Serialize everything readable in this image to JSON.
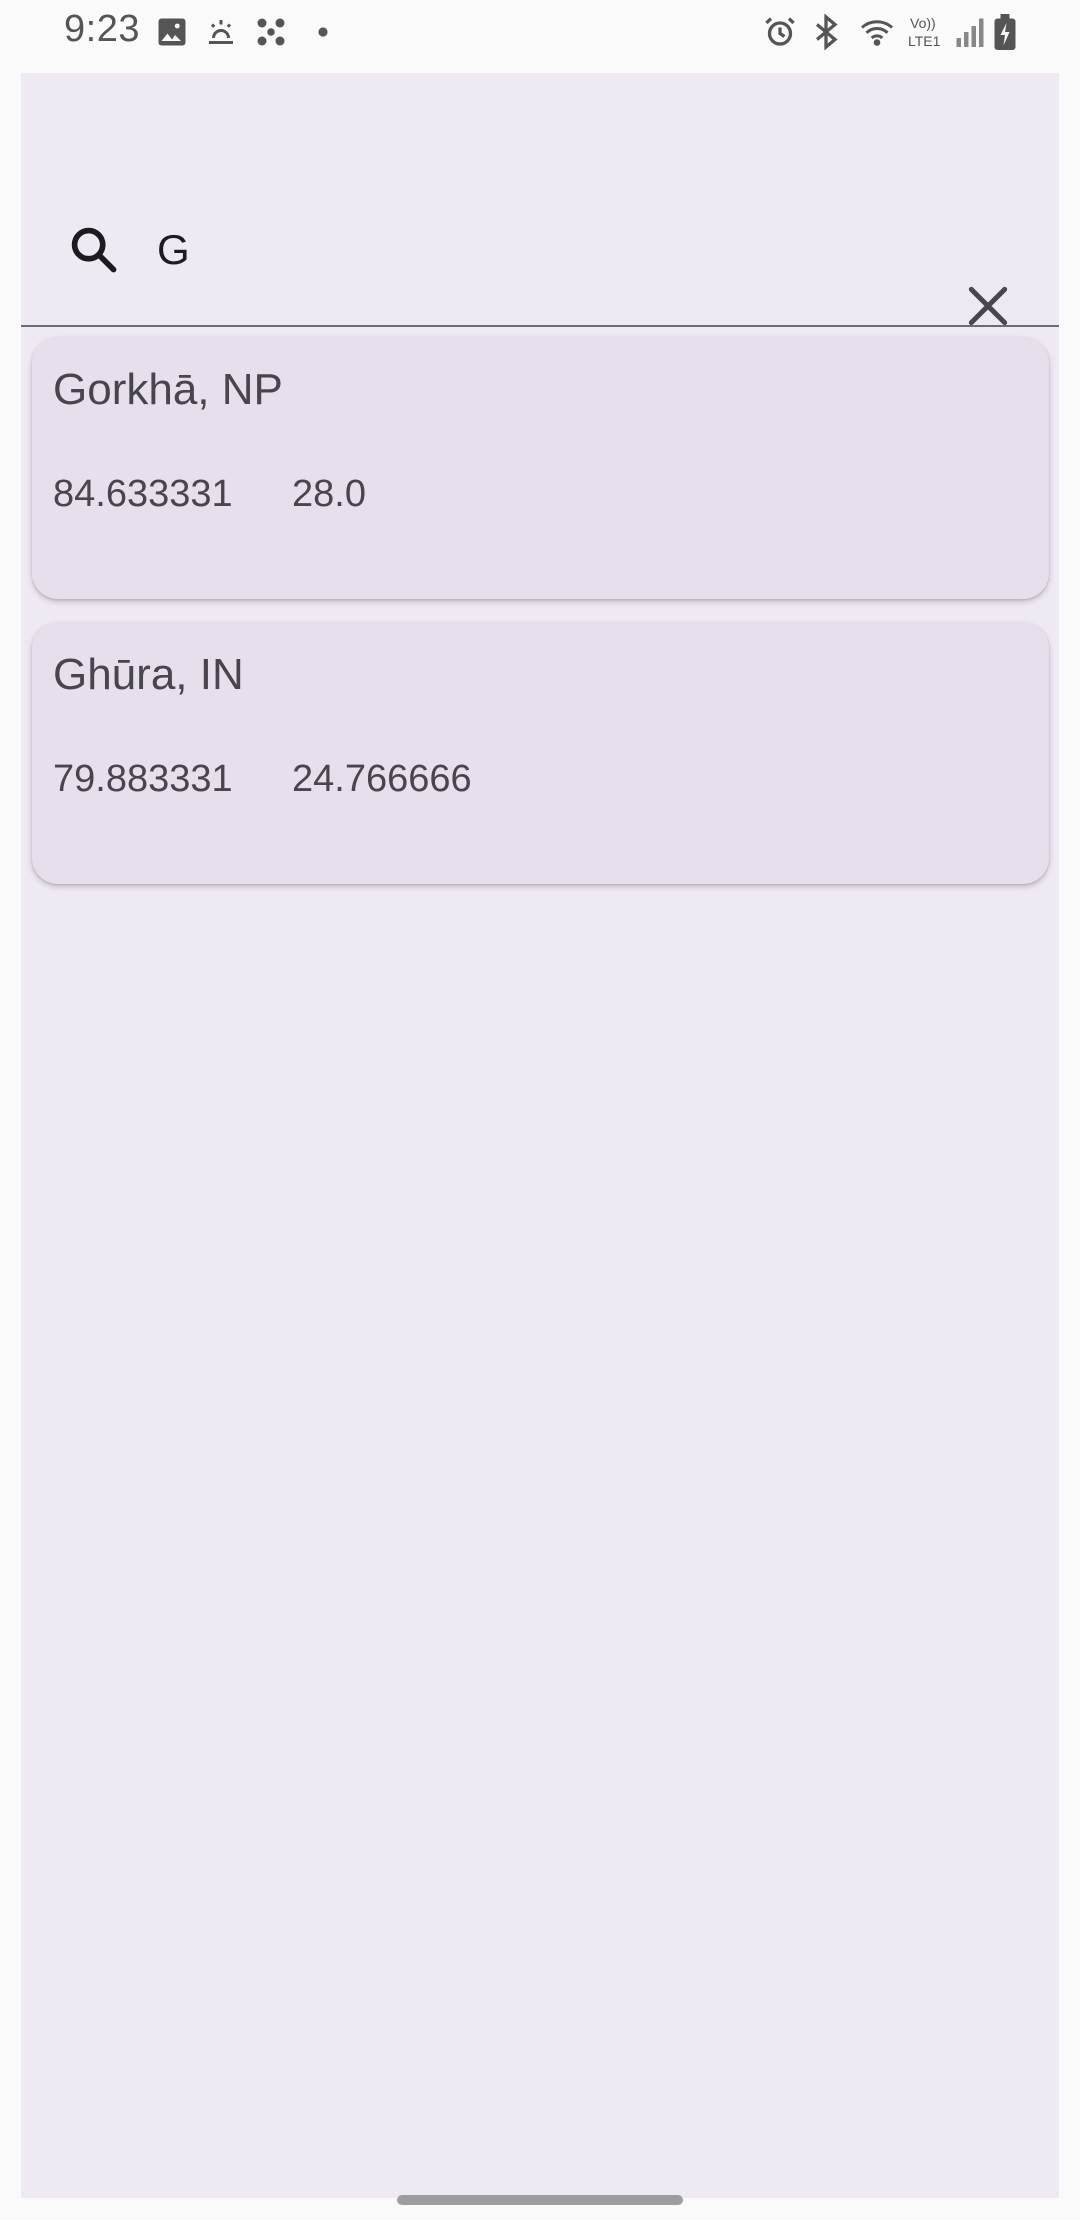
{
  "status_bar": {
    "time": "9:23",
    "left_icons": [
      "image-icon",
      "weather-icon",
      "fan-icon",
      "dot-icon"
    ],
    "right_icons": [
      "alarm-icon",
      "bluetooth-icon",
      "wifi-icon",
      "volte-icon",
      "signal-icon",
      "battery-charging-icon"
    ],
    "volte_label_top": "Vo))",
    "volte_label_bottom": "LTE1"
  },
  "search": {
    "query": "G",
    "icon": "search-icon",
    "clear_icon": "close-icon"
  },
  "results": [
    {
      "title": "Gorkhā, NP",
      "longitude": "84.633331",
      "latitude": "28.0"
    },
    {
      "title": "Ghūra, IN",
      "longitude": "79.883331",
      "latitude": "24.766666"
    }
  ],
  "colors": {
    "surface": "#efe9f4",
    "card": "#e7dfeb",
    "text": "#49454f"
  }
}
